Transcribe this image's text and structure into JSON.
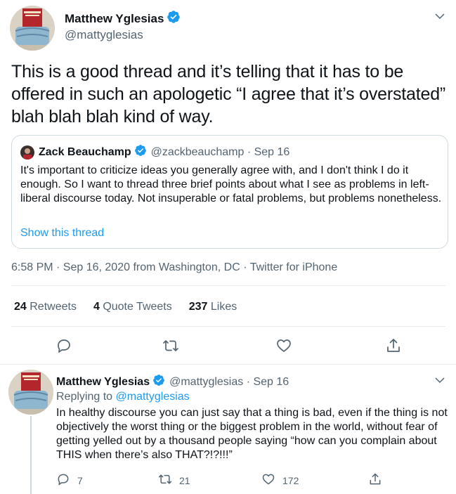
{
  "main_tweet": {
    "name": "Matthew Yglesias",
    "handle": "@mattyglesias",
    "text": "This is a good thread and it’s telling that it has to be offered in such an apologetic “I agree that it’s overstated” blah blah blah kind of way.",
    "meta": "6:58 PM · Sep 16, 2020 from Washington, DC · Twitter for iPhone",
    "stats": {
      "retweets_count": "24",
      "retweets_label": "Retweets",
      "quotes_count": "4",
      "quotes_label": "Quote Tweets",
      "likes_count": "237",
      "likes_label": "Likes"
    }
  },
  "quoted_tweet": {
    "name": "Zack Beauchamp",
    "handle_date": "@zackbeauchamp · Sep 16",
    "text": "It's important to criticize ideas you generally agree with, and I don't think I do it enough. So I want to thread three brief points about what I see as problems in left-liberal discourse today. Not insuperable or fatal problems, but problems nonetheless.",
    "link": "Show this thread"
  },
  "reply_tweet": {
    "name": "Matthew Yglesias",
    "handle_date": "@mattyglesias · Sep 16",
    "replying_prefix": "Replying to",
    "replying_to": "@mattyglesias",
    "text": "In healthy discourse you can just say that a thing is bad, even if the thing is not objectively the worst thing or the biggest problem in the world, without fear of getting yelled out by a thousand people saying “how can you complain about THIS when there’s also THAT?!?!!!”",
    "replies": "7",
    "retweets": "21",
    "likes": "172"
  },
  "icons": {
    "verified": "verified-badge-icon",
    "chevron": "chevron-down-icon",
    "reply": "reply-icon",
    "retweet": "retweet-icon",
    "like": "heart-icon",
    "share": "share-icon"
  },
  "colors": {
    "accent": "#1d9bf0",
    "text": "#0f1419",
    "secondary": "#536471",
    "border": "#cfd9de"
  }
}
